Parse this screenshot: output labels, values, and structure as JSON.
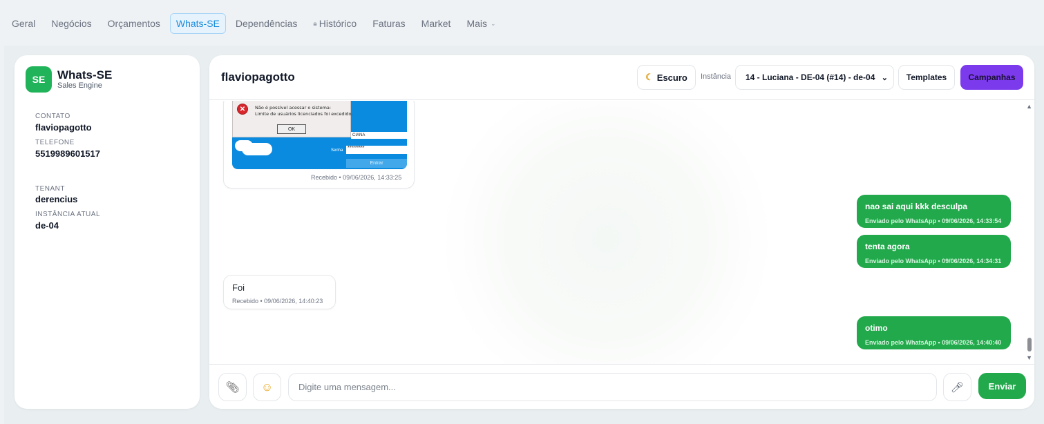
{
  "nav": {
    "tabs": [
      {
        "label": "Geral"
      },
      {
        "label": "Negócios"
      },
      {
        "label": "Orçamentos"
      },
      {
        "label": "Whats-SE"
      },
      {
        "label": "Dependências"
      },
      {
        "label": "Histórico"
      },
      {
        "label": "Faturas"
      },
      {
        "label": "Market"
      },
      {
        "label": "Mais"
      }
    ],
    "active_tab": "Whats-SE"
  },
  "sidebar": {
    "logo_text": "SE",
    "title": "Whats-SE",
    "subtitle": "Sales Engine",
    "contact_label": "CONTATO",
    "contact_value": "flaviopagotto",
    "phone_label": "TELEFONE",
    "phone_value": "5519989601517",
    "tenant_label": "TENANT",
    "tenant_value": "derencius",
    "instance_label": "INSTÂNCIA ATUAL",
    "instance_value": "de-04"
  },
  "chat": {
    "title": "flaviopagotto",
    "dark_mode_label": "Escuro",
    "instance_label": "Instância",
    "instance_selected": "14 - Luciana - DE-04 (#14) - de-04",
    "templates_label": "Templates",
    "campaigns_label": "Campanhas",
    "image_message": {
      "dialog_line1": "Não é possível acessar o sistema:",
      "dialog_line2": "Limite de usuários licenciados foi excedido.",
      "ok_label": "OK",
      "user_field": "CIANA",
      "password_label": "Senha",
      "password_value": "*********",
      "login_button": "Entrar",
      "meta": "Recebido • 09/06/2026, 14:33:25"
    },
    "messages": [
      {
        "direction": "out",
        "text": "nao sai aqui kkk desculpa",
        "meta": "Enviado pelo WhatsApp • 09/06/2026, 14:33:54"
      },
      {
        "direction": "out",
        "text": "tenta agora",
        "meta": "Enviado pelo WhatsApp • 09/06/2026, 14:34:31"
      },
      {
        "direction": "in",
        "text": "Foi",
        "meta": "Recebido • 09/06/2026, 14:40:23"
      },
      {
        "direction": "out",
        "text": "otimo",
        "meta": "Enviado pelo WhatsApp • 09/06/2026, 14:40:40"
      }
    ],
    "composer": {
      "placeholder": "Digite uma mensagem...",
      "send_label": "Enviar"
    }
  },
  "colors": {
    "accent_green": "#21a94b",
    "campaign_purple": "#7c3aed",
    "active_tab_blue": "#1a8cdb"
  }
}
